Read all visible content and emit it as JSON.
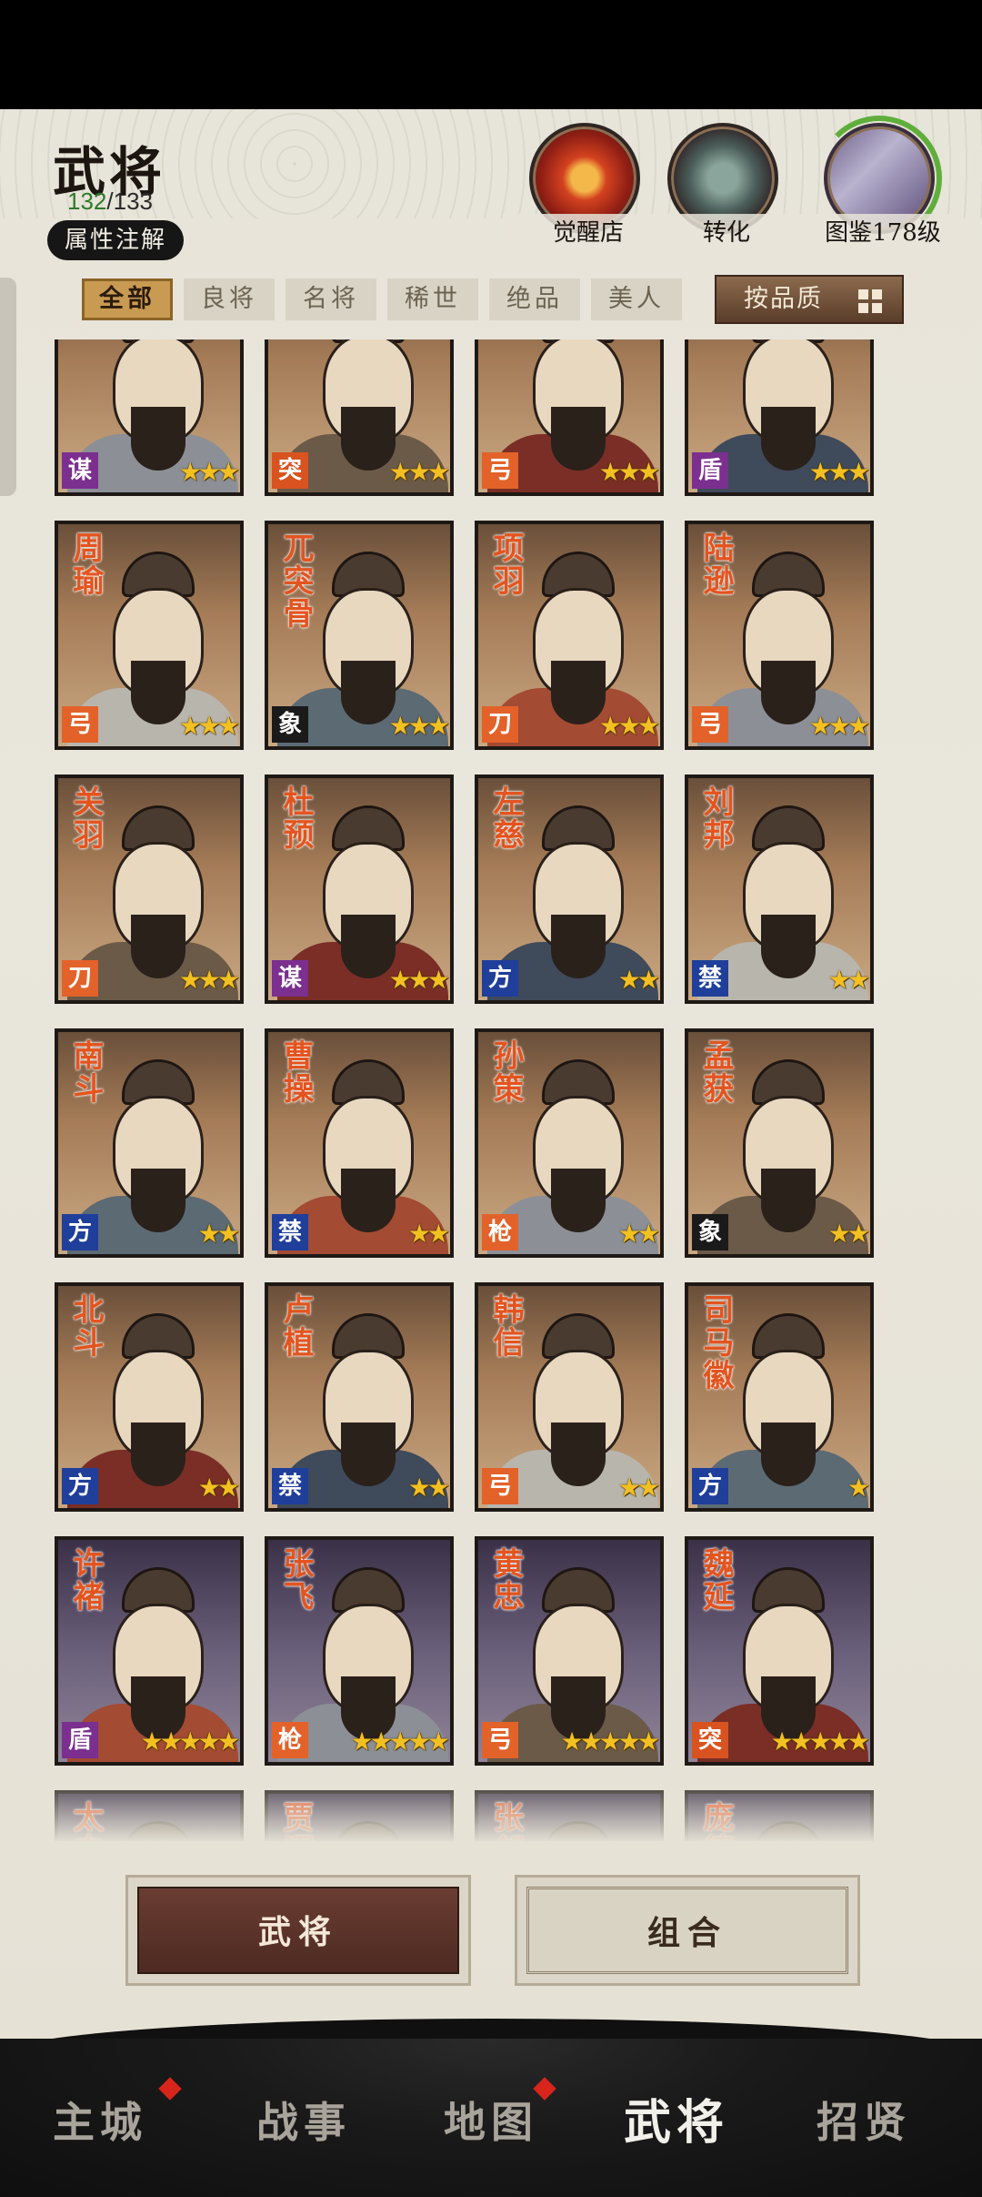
{
  "header": {
    "title": "武将",
    "count_current": "132",
    "count_sep": "/",
    "count_total": "133",
    "attr_button": "属性注解"
  },
  "top_icons": [
    {
      "label": "觉醒店",
      "icon": "awaken-shop-icon"
    },
    {
      "label": "转化",
      "icon": "cauldron-icon"
    },
    {
      "label": "图鉴178级",
      "icon": "codex-icon"
    }
  ],
  "filters": [
    "全部",
    "良将",
    "名将",
    "稀世",
    "绝品",
    "美人"
  ],
  "active_filter": "全部",
  "sort_button": "按品质",
  "heroes": [
    {
      "name": "",
      "cls": "谋",
      "stars": "★★★",
      "cls_color": "#7b2f8f",
      "bg": "bg-brown"
    },
    {
      "name": "",
      "cls": "突",
      "stars": "★★★",
      "cls_color": "#d8531f",
      "bg": "bg-brown"
    },
    {
      "name": "",
      "cls": "弓",
      "stars": "★★★",
      "cls_color": "#e2622a",
      "bg": "bg-brown"
    },
    {
      "name": "",
      "cls": "盾",
      "stars": "★★★",
      "cls_color": "#7b2f8f",
      "bg": "bg-brown"
    },
    {
      "name": "周瑜",
      "cls": "弓",
      "stars": "★★★",
      "cls_color": "#e2622a",
      "bg": "bg-brown"
    },
    {
      "name": "兀突骨",
      "cls": "象",
      "stars": "★★★",
      "cls_color": "#1a1a1a",
      "bg": "bg-brown"
    },
    {
      "name": "项羽",
      "cls": "刀",
      "stars": "★★★",
      "cls_color": "#e2622a",
      "bg": "bg-brown"
    },
    {
      "name": "陆逊",
      "cls": "弓",
      "stars": "★★★",
      "cls_color": "#e2622a",
      "bg": "bg-brown"
    },
    {
      "name": "关羽",
      "cls": "刀",
      "stars": "★★★",
      "cls_color": "#e2622a",
      "bg": "bg-brown"
    },
    {
      "name": "杜预",
      "cls": "谋",
      "stars": "★★★",
      "cls_color": "#7b2f8f",
      "bg": "bg-brown"
    },
    {
      "name": "左慈",
      "cls": "方",
      "stars": "★★",
      "cls_color": "#1f3f9a",
      "bg": "bg-brown"
    },
    {
      "name": "刘邦",
      "cls": "禁",
      "stars": "★★",
      "cls_color": "#1f3f9a",
      "bg": "bg-brown"
    },
    {
      "name": "南斗",
      "cls": "方",
      "stars": "★★",
      "cls_color": "#1f3f9a",
      "bg": "bg-brown"
    },
    {
      "name": "曹操",
      "cls": "禁",
      "stars": "★★",
      "cls_color": "#1f3f9a",
      "bg": "bg-brown"
    },
    {
      "name": "孙策",
      "cls": "枪",
      "stars": "★★",
      "cls_color": "#e2622a",
      "bg": "bg-brown"
    },
    {
      "name": "孟获",
      "cls": "象",
      "stars": "★★",
      "cls_color": "#1a1a1a",
      "bg": "bg-brown"
    },
    {
      "name": "北斗",
      "cls": "方",
      "stars": "★★",
      "cls_color": "#1f3f9a",
      "bg": "bg-brown"
    },
    {
      "name": "卢植",
      "cls": "禁",
      "stars": "★★",
      "cls_color": "#1f3f9a",
      "bg": "bg-brown"
    },
    {
      "name": "韩信",
      "cls": "弓",
      "stars": "★★",
      "cls_color": "#e2622a",
      "bg": "bg-brown"
    },
    {
      "name": "司马徽",
      "cls": "方",
      "stars": "★",
      "cls_color": "#1f3f9a",
      "bg": "bg-brown"
    },
    {
      "name": "许褚",
      "cls": "盾",
      "stars": "★★★★★",
      "cls_color": "#7b2f8f",
      "bg": "bg-purple"
    },
    {
      "name": "张飞",
      "cls": "枪",
      "stars": "★★★★★",
      "cls_color": "#e2622a",
      "bg": "bg-purple"
    },
    {
      "name": "黄忠",
      "cls": "弓",
      "stars": "★★★★★",
      "cls_color": "#e2622a",
      "bg": "bg-purple"
    },
    {
      "name": "魏延",
      "cls": "突",
      "stars": "★★★★★",
      "cls_color": "#d8531f",
      "bg": "bg-purple"
    },
    {
      "name": "太史慈",
      "cls": "",
      "stars": "",
      "cls_color": "#e2622a",
      "bg": "bg-purple"
    },
    {
      "name": "贾诩",
      "cls": "",
      "stars": "",
      "cls_color": "#7b2f8f",
      "bg": "bg-purple"
    },
    {
      "name": "张郃",
      "cls": "",
      "stars": "",
      "cls_color": "#e2622a",
      "bg": "bg-purple"
    },
    {
      "name": "庞德",
      "cls": "",
      "stars": "",
      "cls_color": "#e2622a",
      "bg": "bg-purple"
    }
  ],
  "bottom_buttons": {
    "heroes": "武将",
    "combos": "组合"
  },
  "nav": [
    {
      "label": "主城",
      "badge": true
    },
    {
      "label": "战事",
      "badge": false
    },
    {
      "label": "地图",
      "badge": true
    },
    {
      "label": "武将",
      "badge": false
    },
    {
      "label": "招贤",
      "badge": false
    }
  ],
  "active_nav": "武将"
}
